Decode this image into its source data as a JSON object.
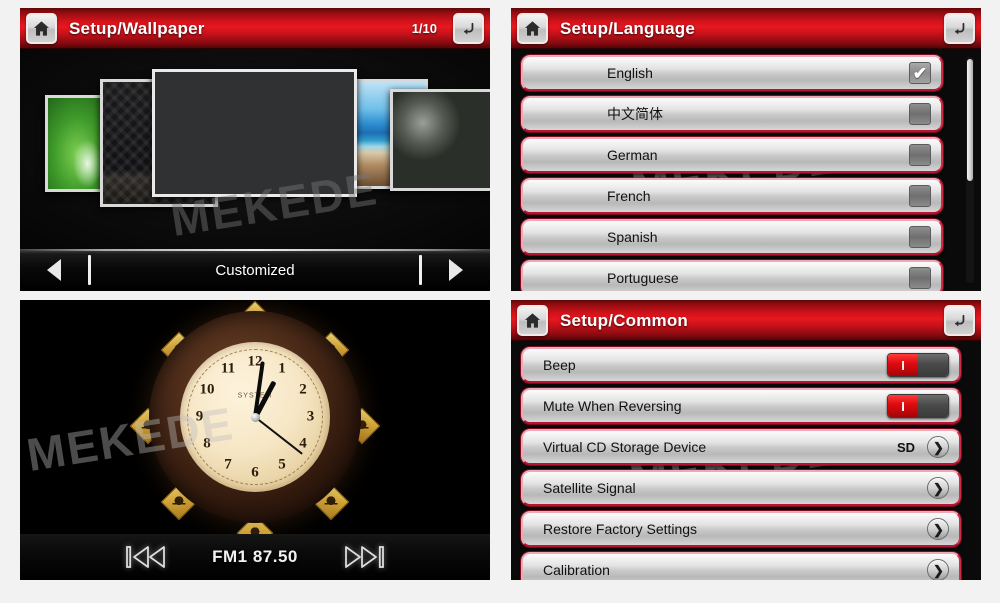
{
  "panels": {
    "wallpaper": {
      "header": {
        "home_icon": "home-icon",
        "title": "Setup/Wallpaper",
        "page_indicator": "1/10",
        "back_icon": "back-arrow-icon"
      },
      "watermark": "MEKEDE",
      "thumbnails": [
        {
          "name": "leaf-wallpaper"
        },
        {
          "name": "damask-wallpaper"
        },
        {
          "name": "customized-wallpaper-selected"
        },
        {
          "name": "beach-wallpaper"
        },
        {
          "name": "gears-wallpaper"
        }
      ],
      "nav": {
        "prev_icon": "triangle-left-icon",
        "label": "Customized",
        "next_icon": "triangle-right-icon"
      }
    },
    "language": {
      "header": {
        "home_icon": "home-icon",
        "title": "Setup/Language",
        "back_icon": "back-arrow-icon"
      },
      "watermark": "MEKEDE",
      "items": [
        {
          "label": "English",
          "checked": true
        },
        {
          "label": "中文简体",
          "checked": false
        },
        {
          "label": "German",
          "checked": false
        },
        {
          "label": "French",
          "checked": false
        },
        {
          "label": "Spanish",
          "checked": false
        },
        {
          "label": "Portuguese",
          "checked": false
        }
      ],
      "check_glyph": "✔"
    },
    "clock": {
      "watermark": "MEKEDE",
      "clock": {
        "numerals": [
          "12",
          "1",
          "2",
          "3",
          "4",
          "5",
          "6",
          "7",
          "8",
          "9",
          "10",
          "11"
        ],
        "brand": "SYSTEM",
        "time": "1:04"
      },
      "radio": {
        "prev_icon": "skip-previous-icon",
        "station": "FM1 87.50",
        "next_icon": "skip-next-icon"
      }
    },
    "common": {
      "header": {
        "home_icon": "home-icon",
        "title": "Setup/Common",
        "back_icon": "back-arrow-icon"
      },
      "watermark": "MEKEDE",
      "items": [
        {
          "label": "Beep",
          "control": "toggle",
          "state": "on",
          "value": ""
        },
        {
          "label": "Mute When Reversing",
          "control": "toggle",
          "state": "on",
          "value": ""
        },
        {
          "label": "Virtual CD Storage Device",
          "control": "chevron",
          "state": "",
          "value": "SD"
        },
        {
          "label": "Satellite Signal",
          "control": "chevron",
          "state": "",
          "value": ""
        },
        {
          "label": "Restore Factory Settings",
          "control": "chevron",
          "state": "",
          "value": ""
        },
        {
          "label": "Calibration",
          "control": "chevron",
          "state": "",
          "value": ""
        }
      ],
      "toggle_on_glyph": "I",
      "chevron_glyph": "❯"
    }
  },
  "colors": {
    "header_red": "#d2121a",
    "row_border_red": "#d32b46",
    "toggle_on_red": "#e00d10",
    "panel_black": "#000000"
  }
}
